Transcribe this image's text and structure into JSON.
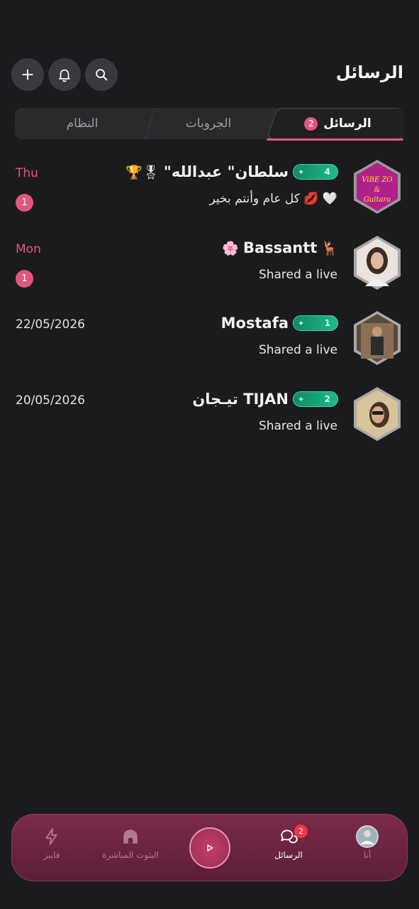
{
  "header": {
    "title": "الرسائل",
    "search_icon": "search-icon",
    "bell_icon": "bell-icon",
    "add_icon": "plus-icon"
  },
  "tabs": [
    {
      "label": "الرسائل",
      "badge": "2",
      "active": true
    },
    {
      "label": "الجروبات",
      "active": false
    },
    {
      "label": "النظام",
      "active": false
    }
  ],
  "accent_color": "#e0577f",
  "conversations": [
    {
      "name": "\"سلطان\" عبدالله",
      "level": "4",
      "message": "كل عام وأنتم بخير 💋 🤍",
      "time": "Thu",
      "unread": "1",
      "avatar_text": [
        "ViBE ZO",
        "&",
        "Guitara"
      ],
      "emojis": "🏆🎖"
    },
    {
      "name": "Bassantt",
      "message": "Shared a live",
      "time": "Mon",
      "unread": "1",
      "emojis_left": "🌸",
      "emojis_right": "🦌"
    },
    {
      "name": "Mostafa",
      "level": "1",
      "message": "Shared a live",
      "time": "22/05/2026"
    },
    {
      "name": "تيـجان TIJAN",
      "level": "2",
      "message": "Shared a live",
      "time": "20/05/2026"
    }
  ],
  "bottom_nav": {
    "items": [
      {
        "label": "أنا",
        "icon": "avatar-icon"
      },
      {
        "label": "الرسائل",
        "icon": "chat-bubbles-icon",
        "badge": "2",
        "active": true
      },
      {
        "label": "",
        "icon": "play-icon"
      },
      {
        "label": "البثوث المباشرة",
        "icon": "home-icon"
      },
      {
        "label": "فايبز",
        "icon": "lightning-icon"
      }
    ]
  }
}
